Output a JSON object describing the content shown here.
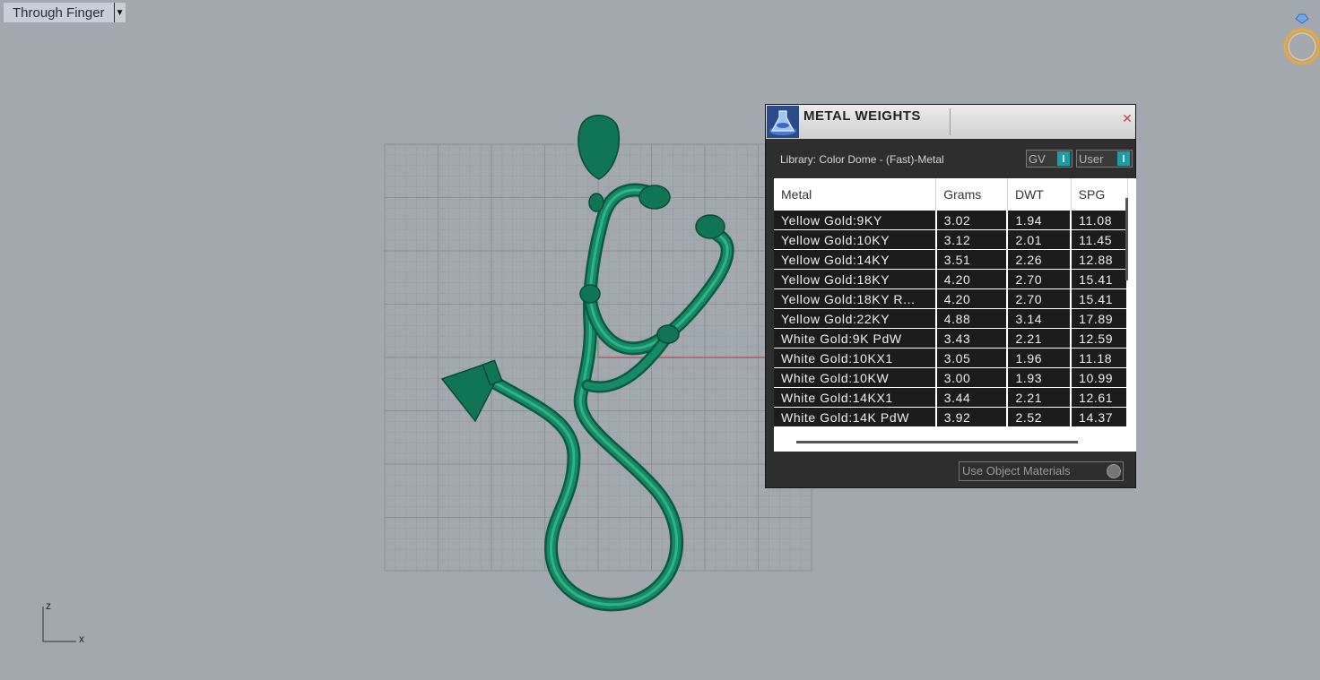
{
  "viewport": {
    "title": "Through Finger",
    "axis_labels": {
      "z": "z",
      "x": "x"
    },
    "model_color": "#117a5c"
  },
  "metal_weights": {
    "title": "METAL WEIGHTS",
    "library_label": "Library: Color Dome - (Fast)-Metal",
    "gv_toggle": "GV",
    "user_toggle": "User",
    "columns": [
      "Metal",
      "Grams",
      "DWT",
      "SPG"
    ],
    "rows": [
      {
        "metal": "Yellow Gold:9KY",
        "grams": "3.02",
        "dwt": "1.94",
        "spg": "11.08"
      },
      {
        "metal": "Yellow Gold:10KY",
        "grams": "3.12",
        "dwt": "2.01",
        "spg": "11.45"
      },
      {
        "metal": "Yellow Gold:14KY",
        "grams": "3.51",
        "dwt": "2.26",
        "spg": "12.88"
      },
      {
        "metal": "Yellow Gold:18KY",
        "grams": "4.20",
        "dwt": "2.70",
        "spg": "15.41"
      },
      {
        "metal": "Yellow Gold:18KY R...",
        "grams": "4.20",
        "dwt": "2.70",
        "spg": "15.41"
      },
      {
        "metal": "Yellow Gold:22KY",
        "grams": "4.88",
        "dwt": "3.14",
        "spg": "17.89"
      },
      {
        "metal": "White Gold:9K PdW",
        "grams": "3.43",
        "dwt": "2.21",
        "spg": "12.59"
      },
      {
        "metal": "White Gold:10KX1",
        "grams": "3.05",
        "dwt": "1.96",
        "spg": "11.18"
      },
      {
        "metal": "White Gold:10KW",
        "grams": "3.00",
        "dwt": "1.93",
        "spg": "10.99"
      },
      {
        "metal": "White Gold:14KX1",
        "grams": "3.44",
        "dwt": "2.21",
        "spg": "12.61"
      },
      {
        "metal": "White Gold:14K PdW",
        "grams": "3.92",
        "dwt": "2.52",
        "spg": "14.37"
      }
    ],
    "use_object_materials": "Use Object Materials"
  }
}
